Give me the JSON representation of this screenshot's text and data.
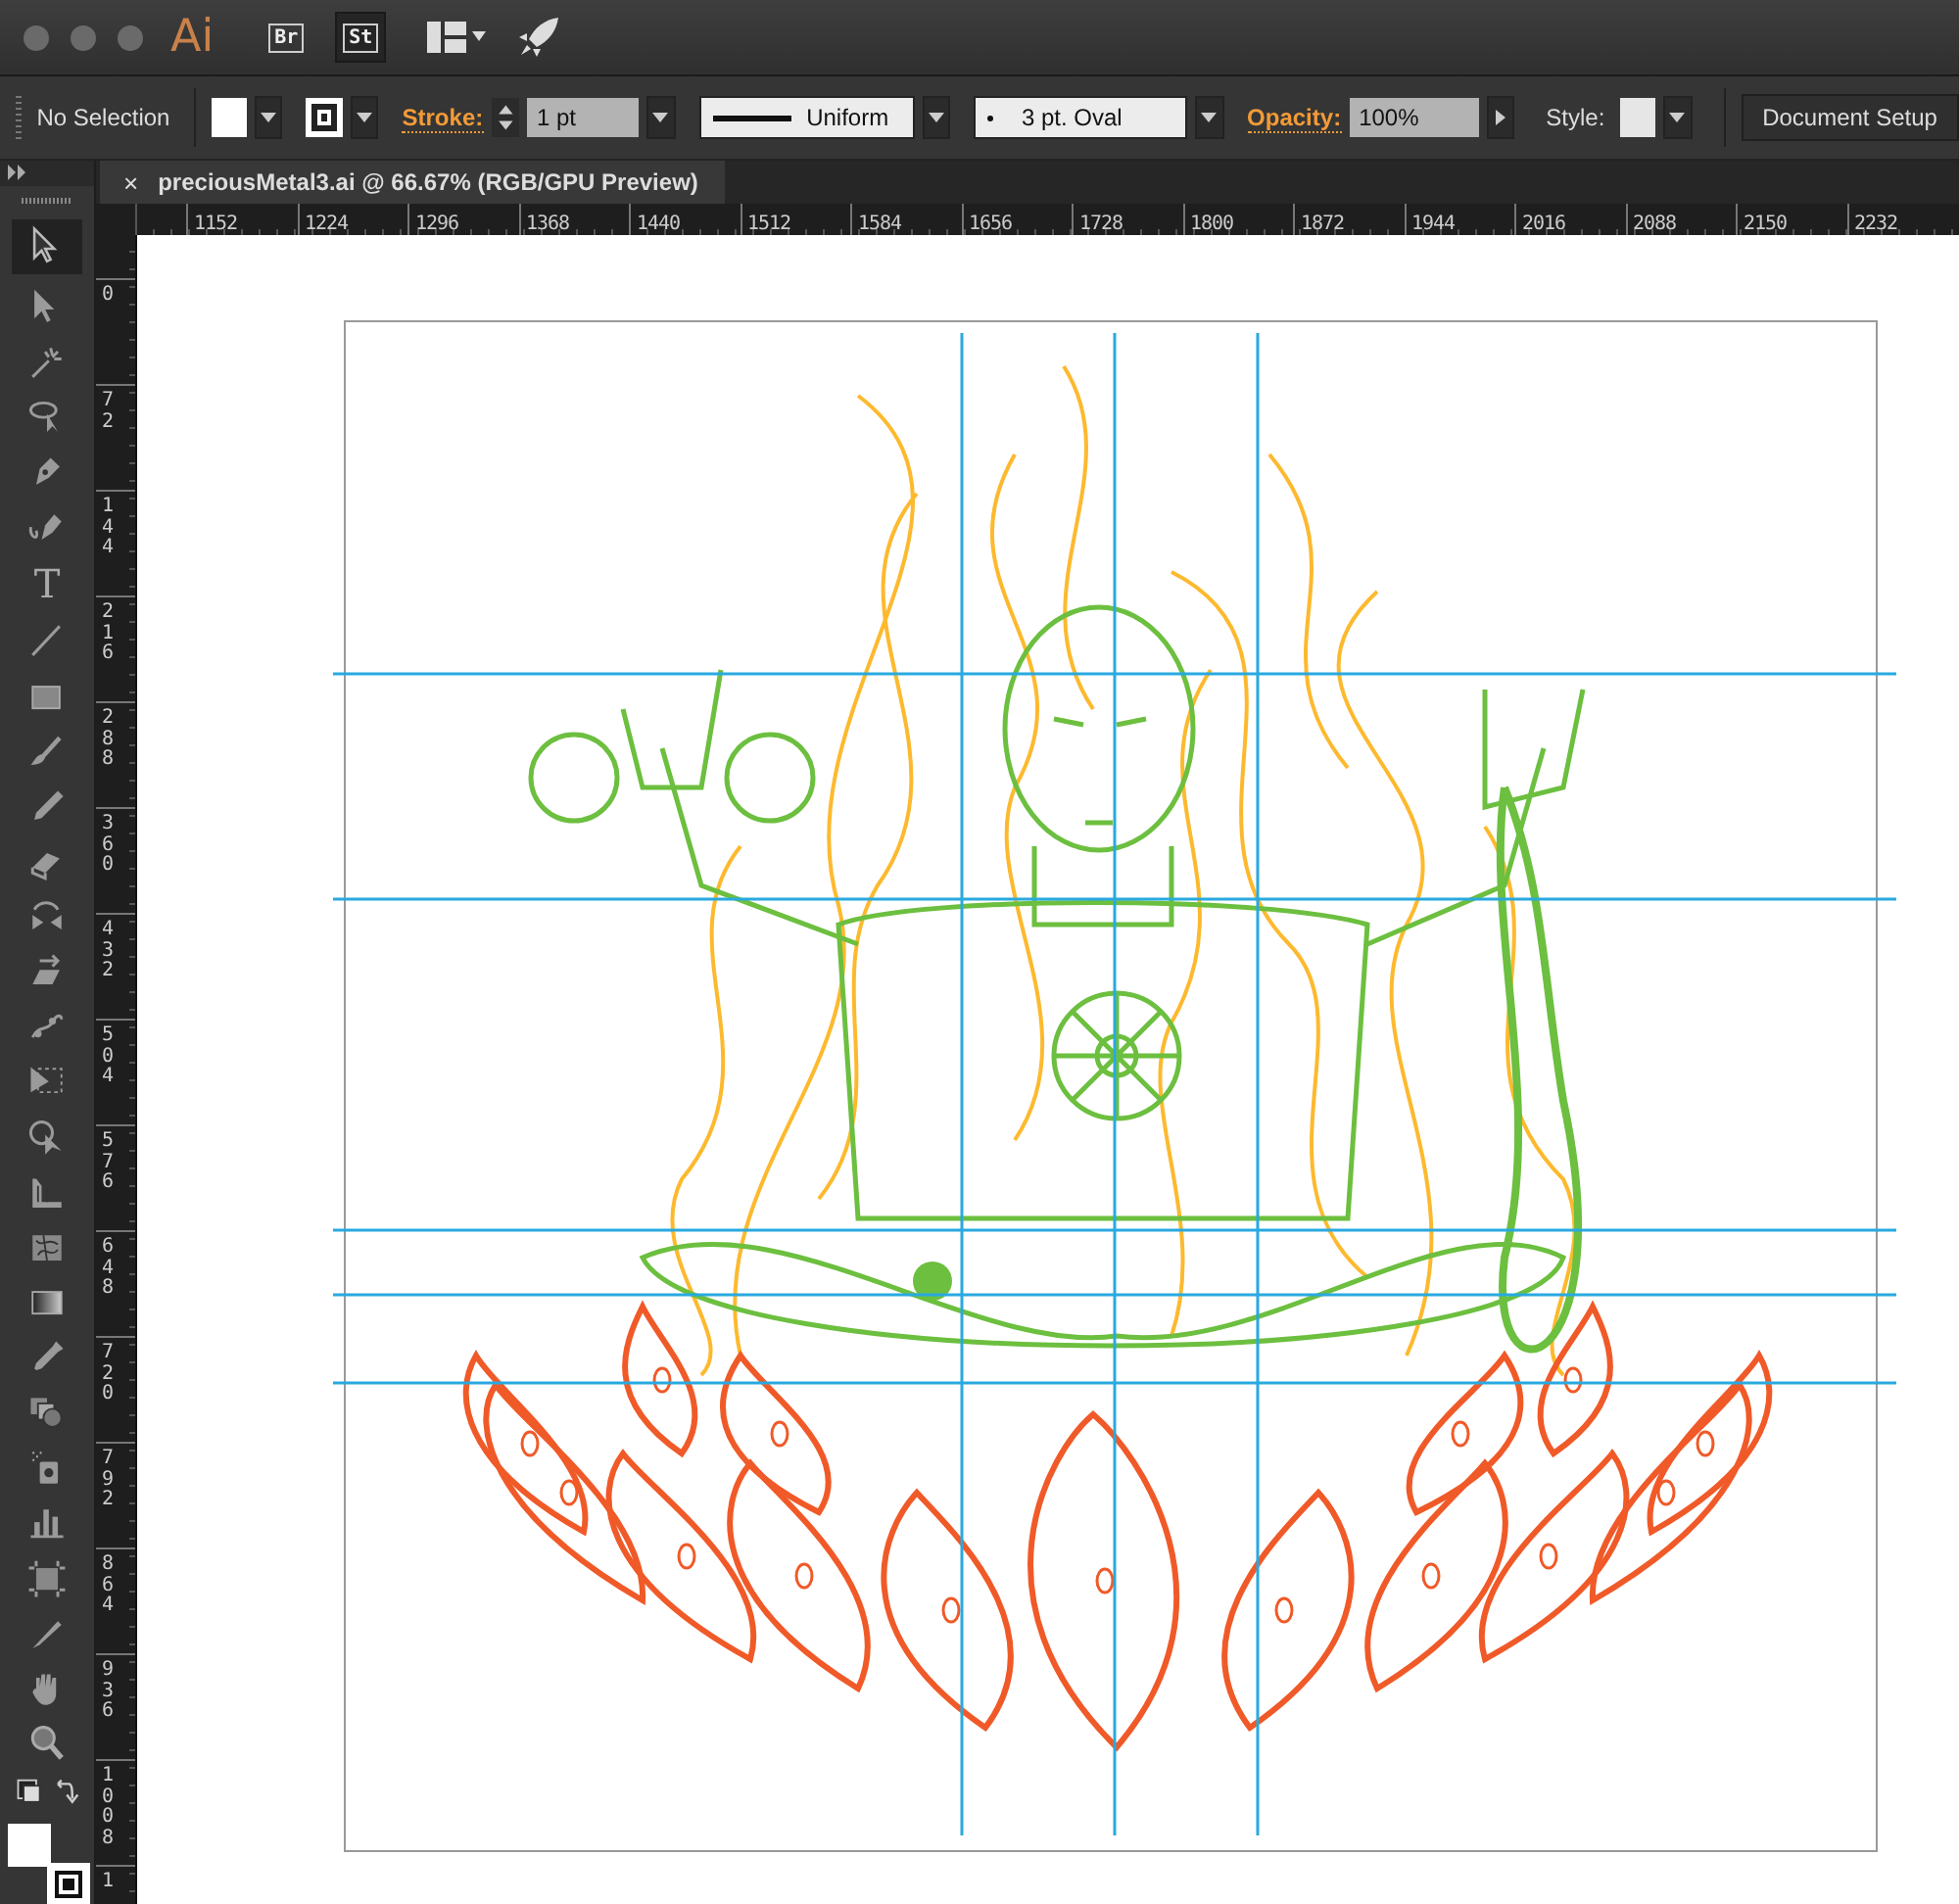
{
  "app_bar": {
    "logo": "Ai",
    "launcher_buttons": [
      {
        "label": "Br",
        "selected": false
      },
      {
        "label": "St",
        "selected": true
      }
    ]
  },
  "control_bar": {
    "selection": "No Selection",
    "stroke_label": "Stroke:",
    "stroke_weight": "1 pt",
    "stroke_profile": "Uniform",
    "brush": "3 pt. Oval",
    "opacity_label": "Opacity:",
    "opacity": "100%",
    "style_label": "Style:",
    "document_setup": "Document Setup"
  },
  "document_tab": {
    "close": "×",
    "title": "preciousMetal3.ai @ 66.67% (RGB/GPU Preview)"
  },
  "toolbar": {
    "type_tool": "T"
  },
  "horizontal_ruler": {
    "labels": [
      "1152",
      "1224",
      "1296",
      "1368",
      "1440",
      "1512",
      "1584",
      "1656",
      "1728",
      "1800",
      "1872",
      "1944",
      "2016",
      "2088",
      "2150",
      "2232"
    ]
  },
  "vertical_ruler": {
    "labels": [
      "0",
      "72",
      "144",
      "216",
      "288",
      "360",
      "432",
      "504",
      "576",
      "648",
      "720",
      "792",
      "864",
      "936",
      "1008",
      "1"
    ]
  }
}
